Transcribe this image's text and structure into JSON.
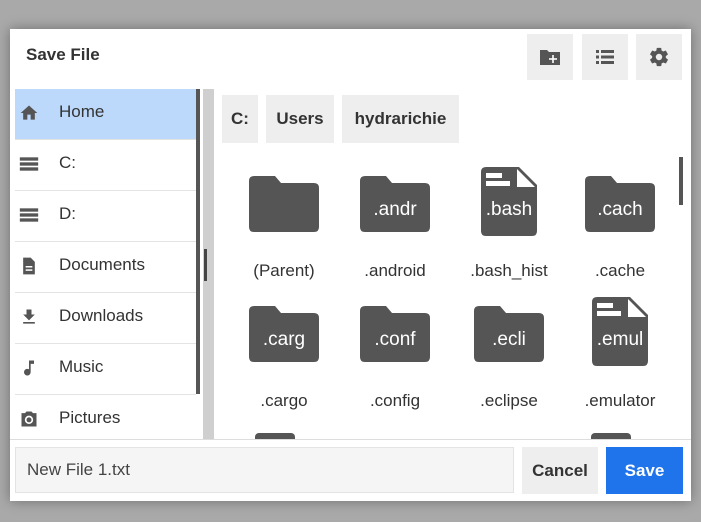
{
  "dialog": {
    "title": "Save File"
  },
  "toolbar": [
    {
      "name": "new-folder-button",
      "icon": "new-folder-icon"
    },
    {
      "name": "view-list-button",
      "icon": "list-view-icon"
    },
    {
      "name": "settings-button",
      "icon": "gear-icon"
    }
  ],
  "sidebar": {
    "items": [
      {
        "label": "Home",
        "icon": "home-icon",
        "active": true
      },
      {
        "label": "C:",
        "icon": "drive-icon"
      },
      {
        "label": "D:",
        "icon": "drive-icon"
      },
      {
        "label": "Documents",
        "icon": "document-icon"
      },
      {
        "label": "Downloads",
        "icon": "download-icon"
      },
      {
        "label": "Music",
        "icon": "music-note-icon"
      },
      {
        "label": "Pictures",
        "icon": "camera-icon"
      }
    ]
  },
  "breadcrumb": [
    "C:",
    "Users",
    "hydrarichie"
  ],
  "files": [
    {
      "name": "(Parent)",
      "badge": "",
      "kind": "folder"
    },
    {
      "name": ".android",
      "badge": ".andr",
      "kind": "folder"
    },
    {
      "name": ".bash_hist",
      "badge": ".bash",
      "kind": "file"
    },
    {
      "name": ".cache",
      "badge": ".cach",
      "kind": "folder"
    },
    {
      "name": ".cargo",
      "badge": ".carg",
      "kind": "folder"
    },
    {
      "name": ".config",
      "badge": ".conf",
      "kind": "folder"
    },
    {
      "name": ".eclipse",
      "badge": ".ecli",
      "kind": "folder"
    },
    {
      "name": ".emulator",
      "badge": ".emul",
      "kind": "file"
    }
  ],
  "footer": {
    "filename_value": "New File 1.txt",
    "cancel_label": "Cancel",
    "save_label": "Save"
  },
  "colors": {
    "accent": "#1f73eb",
    "selected": "#bcd9fb",
    "icon": "#555555"
  }
}
